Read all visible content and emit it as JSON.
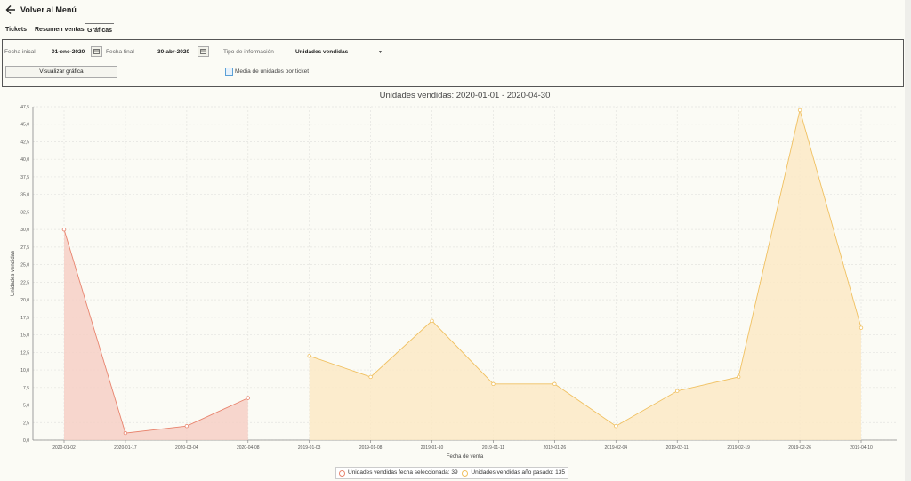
{
  "header": {
    "back_label": "Volver al Menú"
  },
  "tabs": [
    {
      "label": "Tickets"
    },
    {
      "label": "Resumen ventas"
    },
    {
      "label": "Gráficas"
    }
  ],
  "filters": {
    "start_label": "Fecha inical",
    "start_value": "01-ene-2020",
    "end_label": "Fecha final",
    "end_value": "30-abr-2020",
    "info_type_label": "Tipo de información",
    "info_type_value": "Unidades vendidas",
    "show_button": "Visualizar gráfica",
    "avg_checkbox_label": "Media de unidades por ticket"
  },
  "chart_data": {
    "type": "area",
    "title": "Unidades vendidas: 2020-01-01 - 2020-04-30",
    "xlabel": "Fecha de venta",
    "ylabel": "Unidades vendidas",
    "ylim": [
      0,
      47.5
    ],
    "yticks": [
      "0,0",
      "2,5",
      "5,0",
      "7,5",
      "10,0",
      "12,5",
      "15,0",
      "17,5",
      "20,0",
      "22,5",
      "25,0",
      "27,5",
      "30,0",
      "32,5",
      "35,0",
      "37,5",
      "40,0",
      "42,5",
      "45,0",
      "47,5"
    ],
    "grid": true,
    "categories": [
      "2020-01-02",
      "2020-01-17",
      "2020-03-04",
      "2020-04-08",
      "2019-01-03",
      "2019-01-08",
      "2019-01-10",
      "2019-01-11",
      "2019-01-26",
      "2019-02-04",
      "2019-02-11",
      "2019-02-19",
      "2019-02-26",
      "2019-04-10"
    ],
    "series": [
      {
        "name": "Unidades vendidas fecha seleccionada: 39",
        "color": "#e8846e",
        "fill": "#f6cfc6",
        "values": [
          30,
          1,
          2,
          6,
          null,
          null,
          null,
          null,
          null,
          null,
          null,
          null,
          null,
          null
        ]
      },
      {
        "name": "Unidades vendidas año pasado: 135",
        "color": "#f0c060",
        "fill": "#fbe9c6",
        "values": [
          null,
          null,
          null,
          null,
          12,
          9,
          17,
          8,
          8,
          2,
          7,
          9,
          47,
          16
        ]
      }
    ],
    "legend_position": "bottom"
  }
}
